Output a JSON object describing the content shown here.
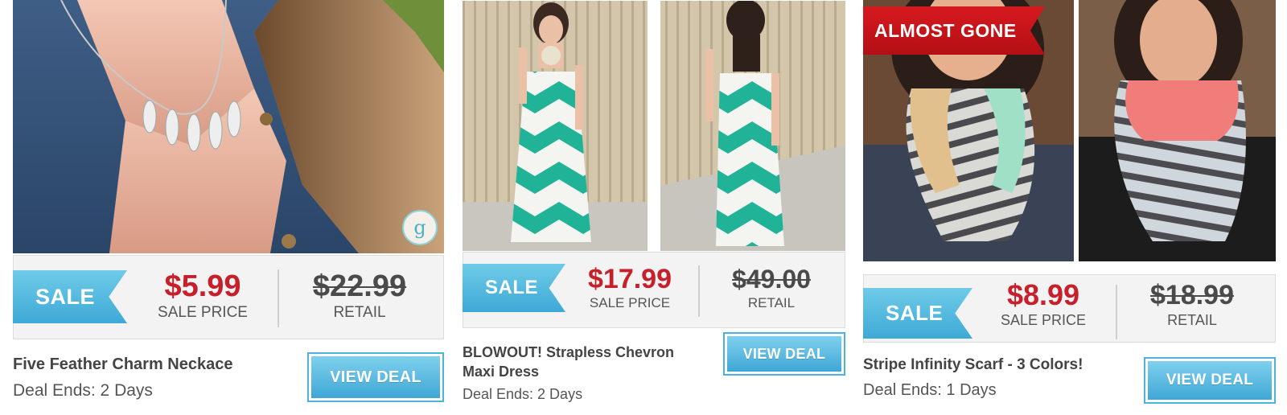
{
  "deals": [
    {
      "photo_alt": "necklace",
      "sale_badge": "SALE",
      "sale_price": "$5.99",
      "sale_price_label": "SALE PRICE",
      "retail_price": "$22.99",
      "retail_label": "RETAIL",
      "title": "Five Feather Charm Neckace",
      "deal_ends": "Deal Ends: 2 Days",
      "button_label": "VIEW DEAL"
    },
    {
      "photo_alt": "dress",
      "sale_badge": "SALE",
      "sale_price": "$17.99",
      "sale_price_label": "SALE PRICE",
      "retail_price": "$49.00",
      "retail_label": "RETAIL",
      "title": "BLOWOUT! Strapless Chevron Maxi Dress",
      "deal_ends": "Deal Ends: 2 Days",
      "button_label": "VIEW DEAL"
    },
    {
      "photo_alt": "scarf",
      "stock_badge": "ALMOST GONE",
      "sale_badge": "SALE",
      "sale_price": "$8.99",
      "sale_price_label": "SALE PRICE",
      "retail_price": "$18.99",
      "retail_label": "RETAIL",
      "title": "Stripe Infinity Scarf - 3 Colors!",
      "deal_ends": "Deal Ends: 1 Days",
      "button_label": "VIEW DEAL"
    }
  ],
  "colors": {
    "sale_price": "#c7202a",
    "retail_price": "#4a4a4a",
    "accent_blue": "#3fa7d5",
    "badge_red": "#c4141a"
  },
  "icons": {
    "logo_badge": "g"
  }
}
